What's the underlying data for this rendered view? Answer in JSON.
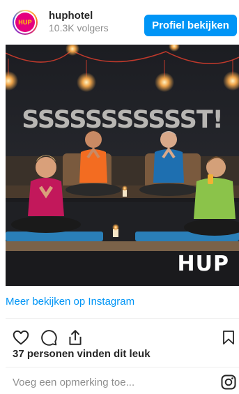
{
  "header": {
    "avatar_text": "HUP",
    "username": "huphotel",
    "followers": "10.3K volgers",
    "profile_button": "Profiel bekijken"
  },
  "photo": {
    "wall_text": "SSSSSSSSSSST!",
    "logo_text": "HUP"
  },
  "link": {
    "label": "Meer bekijken op Instagram"
  },
  "actions": {
    "icons": [
      "heart-icon",
      "comment-icon",
      "share-icon",
      "bookmark-icon"
    ]
  },
  "likes": {
    "text": "37 personen vinden dit leuk"
  },
  "comment": {
    "placeholder": "Voeg een opmerking toe..."
  },
  "colors": {
    "accent": "#0095f6",
    "brand_pink": "#e5007e",
    "brand_yellow": "#ffd200"
  }
}
